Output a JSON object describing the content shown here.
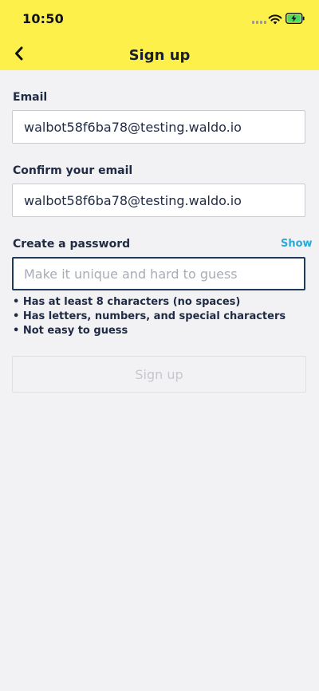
{
  "status_bar": {
    "time": "10:50"
  },
  "nav": {
    "title": "Sign up"
  },
  "form": {
    "email": {
      "label": "Email",
      "value": "walbot58f6ba78@testing.waldo.io"
    },
    "confirm_email": {
      "label": "Confirm your email",
      "value": "walbot58f6ba78@testing.waldo.io"
    },
    "password": {
      "label": "Create a password",
      "show_label": "Show",
      "placeholder": "Make it unique and hard to guess",
      "value": ""
    },
    "rules": [
      "• Has at least 8 characters (no spaces)",
      "• Has letters, numbers, and special characters",
      "• Not easy to guess"
    ],
    "submit_label": "Sign up"
  },
  "colors": {
    "header_bg": "#fef04a",
    "page_bg": "#f2f2f4",
    "link": "#2aa9d6",
    "text": "#1f2a44"
  },
  "icons": {
    "back": "chevron-left-icon",
    "wifi": "wifi-icon",
    "battery": "battery-charging-icon",
    "signal": "cellular-signal-icon"
  }
}
